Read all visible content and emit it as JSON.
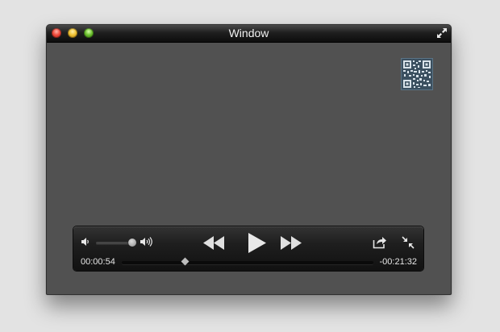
{
  "window": {
    "title": "Window",
    "buttons": [
      "close",
      "minimize",
      "zoom"
    ],
    "fullscreen_icon": "expand-arrows-icon"
  },
  "video": {
    "overlay_icon": "qr-code-icon"
  },
  "player": {
    "elapsed": "00:00:54",
    "remaining": "-00:21:32",
    "volume_level": 0.9,
    "progress": 0.25,
    "icons": {
      "volume_low": "speaker-low-icon",
      "volume_high": "speaker-high-icon",
      "rewind": "rewind-icon",
      "play": "play-icon",
      "fast_forward": "fast-forward-icon",
      "share": "share-icon",
      "exit_fullscreen": "shrink-arrows-icon"
    }
  },
  "colors": {
    "desktop": "#e3e3e3",
    "window_body": "#515151",
    "controls_bg": "#1e1e1e",
    "text": "#e6e6e6"
  }
}
